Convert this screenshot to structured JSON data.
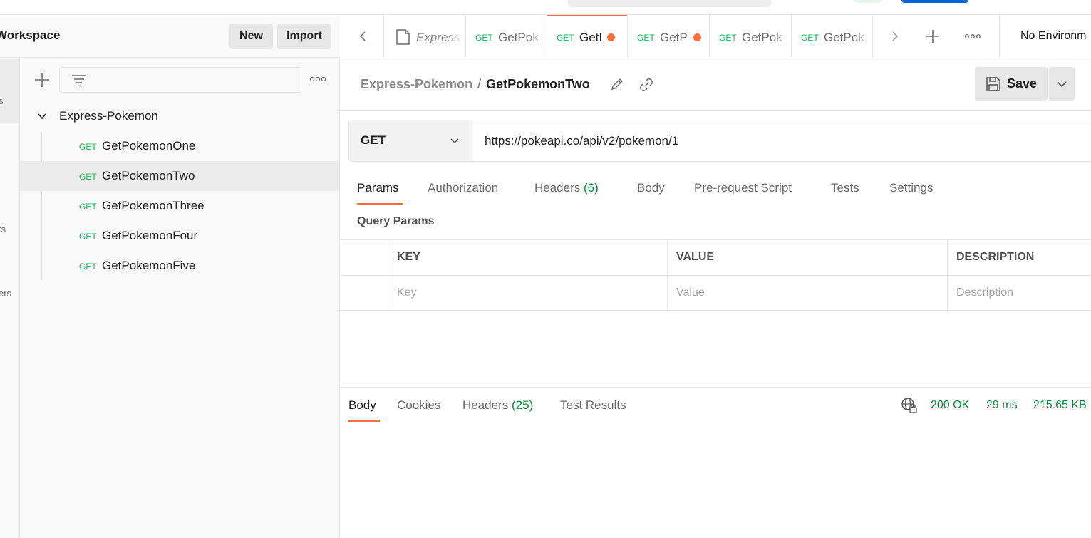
{
  "workspace": {
    "title": "Workspace",
    "new_label": "New",
    "import_label": "Import"
  },
  "rail": {
    "labels": [
      "s",
      "ts",
      "ers"
    ]
  },
  "sidebar": {
    "collection": "Express-Pokemon",
    "items": [
      {
        "method": "GET",
        "name": "GetPokemonOne",
        "selected": false
      },
      {
        "method": "GET",
        "name": "GetPokemonTwo",
        "selected": true
      },
      {
        "method": "GET",
        "name": "GetPokemonThree",
        "selected": false
      },
      {
        "method": "GET",
        "name": "GetPokemonFour",
        "selected": false
      },
      {
        "method": "GET",
        "name": "GetPokemonFive",
        "selected": false
      }
    ]
  },
  "tabs": [
    {
      "type": "collection",
      "label": "Express",
      "italic": true
    },
    {
      "method": "GET",
      "label": "GetPok",
      "unsaved": false,
      "active": false
    },
    {
      "method": "GET",
      "label": "GetI",
      "unsaved": true,
      "active": true
    },
    {
      "method": "GET",
      "label": "GetP",
      "unsaved": true,
      "active": false
    },
    {
      "method": "GET",
      "label": "GetPok",
      "unsaved": false,
      "active": false
    },
    {
      "method": "GET",
      "label": "GetPok",
      "unsaved": false,
      "active": false
    }
  ],
  "environment": {
    "label": "No Environm"
  },
  "breadcrumb": {
    "parent": "Express-Pokemon",
    "separator": "/",
    "current": "GetPokemonTwo"
  },
  "save": {
    "label": "Save"
  },
  "request": {
    "method": "GET",
    "url": "https://pokeapi.co/api/v2/pokemon/1"
  },
  "request_tabs": [
    {
      "label": "Params",
      "count": "",
      "active": true
    },
    {
      "label": "Authorization",
      "count": "",
      "active": false
    },
    {
      "label": "Headers",
      "count": "(6)",
      "active": false
    },
    {
      "label": "Body",
      "count": "",
      "active": false
    },
    {
      "label": "Pre-request Script",
      "count": "",
      "active": false
    },
    {
      "label": "Tests",
      "count": "",
      "active": false
    },
    {
      "label": "Settings",
      "count": "",
      "active": false
    }
  ],
  "query_params": {
    "title": "Query Params",
    "headers": [
      "KEY",
      "VALUE",
      "DESCRIPTION"
    ],
    "placeholders": {
      "key": "Key",
      "value": "Value",
      "description": "Description"
    }
  },
  "response": {
    "tabs": [
      {
        "label": "Body",
        "count": "",
        "active": true
      },
      {
        "label": "Cookies",
        "count": "",
        "active": false
      },
      {
        "label": "Headers",
        "count": "(25)",
        "active": false
      },
      {
        "label": "Test Results",
        "count": "",
        "active": false
      }
    ],
    "status": "200 OK",
    "time": "29 ms",
    "size": "215.65 KB"
  },
  "colors": {
    "accent": "#ff6c37",
    "method_get": "#0cbb52",
    "status_green": "#0b8a3e"
  }
}
